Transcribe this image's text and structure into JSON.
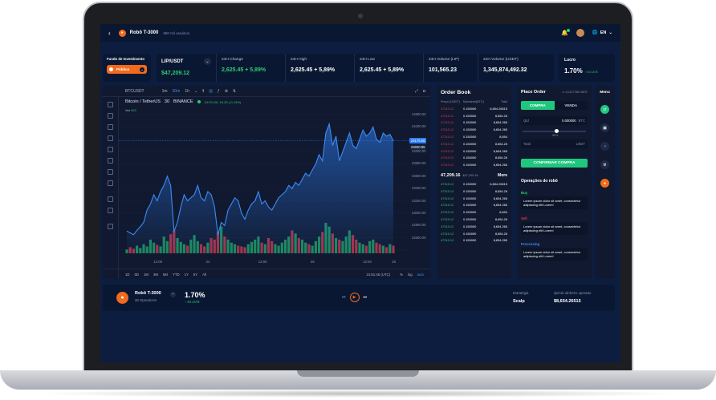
{
  "header": {
    "back_icon": "chevron-left-icon",
    "bot_name": "Robô T-3000",
    "users": "980 mil usuários",
    "lang": "EN"
  },
  "fund": {
    "label": "Fundo de Investimento",
    "selected": "Público"
  },
  "stats": {
    "pair": "LIP/USDT",
    "pair_price": "$47,209.12",
    "items": [
      {
        "label": "24H Change",
        "value": "2,625.45 + 5,89%"
      },
      {
        "label": "24H High",
        "value": "2,625.45 + 5,89%"
      },
      {
        "label": "24H Low",
        "value": "2,625.45 + 5,89%"
      },
      {
        "label": "24H Volume (LIP)",
        "value": "101,565.23"
      },
      {
        "label": "24H Volume (USDT)",
        "value": "1,345,874,492.32"
      }
    ]
  },
  "lucro": {
    "label": "Lucro",
    "value": "1.70%",
    "sub": "40.1478"
  },
  "chart_toolbar": {
    "symbol": "BTCUSDT",
    "intervals": [
      "1m",
      "30m",
      "1h"
    ]
  },
  "chart_info": {
    "title": "Bitcoin / TetherUS",
    "interval": "30",
    "exchange": "BINANCE",
    "ohlc": "24175.06  -15.25 (-0.13%)",
    "vol_label": "Vol",
    "vol_value": "403"
  },
  "chart_bottom": {
    "ranges": [
      "1D",
      "5D",
      "1M",
      "3M",
      "6M",
      "YTD",
      "1Y",
      "5Y",
      "All"
    ],
    "time": "21:51:45 (UTC)",
    "pct": "%",
    "log": "log",
    "auto": "auto"
  },
  "chart_data": {
    "type": "line",
    "ylim": [
      22400,
      24600
    ],
    "yticks": [
      24600,
      24400,
      24200,
      24000,
      23800,
      23600,
      23400,
      23200,
      23000,
      22800,
      22600,
      22400
    ],
    "ytick_labels": [
      "24600.00",
      "24400.00",
      "24200.00",
      "24000.00",
      "23800.00",
      "23600.00",
      "23400.00",
      "23200.00",
      "23000.00",
      "22800.00",
      "22600.00",
      ""
    ],
    "price_badge": "24175.06",
    "price_badge2": "24030.95",
    "xtick_labels": [
      "12:00",
      "24",
      "12:00",
      "25",
      "12:00",
      "26"
    ],
    "x": [
      0,
      1,
      2,
      3,
      4,
      5,
      6,
      7,
      8,
      9,
      10,
      11,
      12,
      13,
      14,
      15,
      16,
      17,
      18,
      19,
      20,
      21,
      22,
      23,
      24,
      25,
      26,
      27,
      28,
      29,
      30,
      31,
      32,
      33,
      34,
      35,
      36,
      37,
      38,
      39,
      40,
      41,
      42,
      43,
      44,
      45,
      46,
      47,
      48,
      49,
      50,
      51,
      52,
      53,
      54,
      55,
      56,
      57,
      58,
      59,
      60,
      61,
      62,
      63,
      64,
      65,
      66,
      67,
      68,
      69,
      70,
      71,
      72,
      73,
      74,
      75,
      76,
      77,
      78,
      79
    ],
    "values": [
      22710,
      22680,
      22650,
      22720,
      22780,
      22850,
      23050,
      23150,
      23300,
      23200,
      23350,
      23450,
      23600,
      23450,
      22700,
      22850,
      23100,
      23300,
      23200,
      23250,
      23300,
      23450,
      23250,
      23200,
      23350,
      23300,
      23100,
      22650,
      22850,
      22800,
      23050,
      23150,
      23250,
      23200,
      23000,
      22900,
      23050,
      23150,
      23200,
      23350,
      23150,
      23200,
      23100,
      23050,
      23150,
      23250,
      23300,
      23350,
      23450,
      23400,
      23500,
      23450,
      23550,
      23650,
      23600,
      23700,
      23800,
      23950,
      23850,
      24300,
      24450,
      24100,
      24250,
      23850,
      24000,
      24150,
      24300,
      24100,
      24050,
      24200,
      24350,
      24250,
      24300,
      24400,
      24200,
      24150,
      24300,
      24250,
      24280,
      24175
    ],
    "volume": [
      5,
      8,
      6,
      10,
      7,
      12,
      9,
      18,
      14,
      11,
      9,
      22,
      16,
      25,
      30,
      20,
      15,
      12,
      10,
      18,
      24,
      16,
      12,
      9,
      14,
      20,
      18,
      28,
      35,
      22,
      18,
      14,
      12,
      10,
      9,
      8,
      12,
      15,
      18,
      22,
      14,
      12,
      20,
      16,
      12,
      10,
      14,
      18,
      22,
      30,
      26,
      20,
      18,
      14,
      12,
      10,
      16,
      22,
      28,
      40,
      35,
      26,
      20,
      18,
      16,
      22,
      30,
      24,
      18,
      14,
      12,
      10,
      16,
      18,
      14,
      12,
      10,
      8,
      12,
      10
    ]
  },
  "order_book": {
    "title": "Order Book",
    "headers": [
      "Preço (USDT)",
      "Montante(BTC)",
      "Total"
    ],
    "asks": [
      {
        "price": "47315.12",
        "amount": "0.150000",
        "total": "6,654.26515"
      },
      {
        "price": "47315.12",
        "amount": "0.150000",
        "total": "8,654.26"
      },
      {
        "price": "47315.12",
        "amount": "0.150000",
        "total": "8,654.265"
      },
      {
        "price": "47315.12",
        "amount": "0.150000",
        "total": "6,654.265"
      },
      {
        "price": "47315.12",
        "amount": "0.150000",
        "total": "8,654"
      },
      {
        "price": "47315.12",
        "amount": "0.150000",
        "total": "8,654.26"
      },
      {
        "price": "47315.12",
        "amount": "0.150000",
        "total": "6,654.265"
      },
      {
        "price": "47315.12",
        "amount": "0.150000",
        "total": "8,654.26"
      },
      {
        "price": "47315.12",
        "amount": "0.150000",
        "total": "6,654.265"
      }
    ],
    "mid_price": "47,209.16",
    "mid_sub": "$47,209.16",
    "more": "More",
    "bids": [
      {
        "price": "47315.12",
        "amount": "0.150000",
        "total": "6,654.26515"
      },
      {
        "price": "47315.12",
        "amount": "0.150000",
        "total": "8,654.26"
      },
      {
        "price": "47315.12",
        "amount": "0.150000",
        "total": "8,654.265"
      },
      {
        "price": "47315.12",
        "amount": "0.150000",
        "total": "6,654.265"
      },
      {
        "price": "47315.12",
        "amount": "0.150000",
        "total": "8,654"
      },
      {
        "price": "47315.12",
        "amount": "0.150000",
        "total": "8,654.26"
      },
      {
        "price": "47315.12",
        "amount": "0.150000",
        "total": "6,654.265"
      },
      {
        "price": "47315.12",
        "amount": "0.150000",
        "total": "8,654.26"
      },
      {
        "price": "47315.12",
        "amount": "0.150000",
        "total": "6,654.265"
      }
    ]
  },
  "place_order": {
    "title": "Place Order",
    "balance": "0,0117738 USDT",
    "tab_buy": "COMPRA",
    "tab_sell": "VENDA",
    "qty_label": "Qtd",
    "qty_value": "0.000000",
    "qty_unit": "BTC",
    "slider_label": "50%",
    "slider_value": 0.5,
    "total_label": "Total",
    "total_unit": "USDT",
    "confirm": "CONFIRMAR COMPRA",
    "ops_title": "Operações do robô",
    "ops": [
      {
        "status": "Buy",
        "text": "Lorem ipsum dolor sit amet, consectetur adipiscing elit Lorem!"
      },
      {
        "status": "Sell",
        "text": "Lorem ipsum dolor sit amet, consectetur adipiscing elit Lorem!"
      },
      {
        "status": "Processing",
        "text": "Lorem ipsum dolor sit amet, consectetur adipiscing elit Lorem!"
      }
    ]
  },
  "menu": {
    "title": "Menu"
  },
  "bottom": {
    "bot_name": "Robô T-3000",
    "operations": "38 Operations",
    "pct": "1.70%",
    "pct_sub": "40.1478",
    "strategy_label": "Estratégia",
    "strategy_value": "Scalp",
    "qty_label": "Qtd de dinheiro operado",
    "qty_value": "$8,654.26515"
  },
  "colors": {
    "accent": "#f26a1b",
    "green": "#2ecc71",
    "red": "#e8364c",
    "blue": "#3d8bf5",
    "bg": "#0d1d3f"
  }
}
